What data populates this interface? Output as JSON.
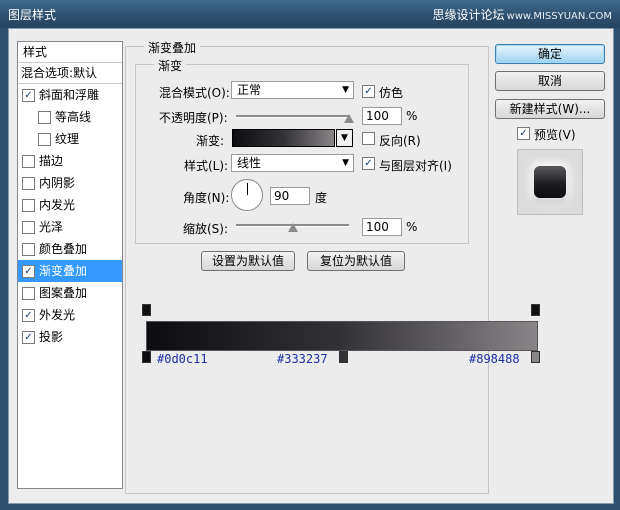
{
  "window": {
    "title": "图层样式",
    "watermark": "思缘设计论坛",
    "watermark_url": "www.MISSYUAN.COM"
  },
  "stylelist": {
    "header": "样式",
    "blend_options": "混合选项:默认",
    "items": [
      {
        "label": "斜面和浮雕",
        "checked": true,
        "indent": false,
        "selected": false
      },
      {
        "label": "等高线",
        "checked": false,
        "indent": true,
        "selected": false
      },
      {
        "label": "纹理",
        "checked": false,
        "indent": true,
        "selected": false
      },
      {
        "label": "描边",
        "checked": false,
        "indent": false,
        "selected": false
      },
      {
        "label": "内阴影",
        "checked": false,
        "indent": false,
        "selected": false
      },
      {
        "label": "内发光",
        "checked": false,
        "indent": false,
        "selected": false
      },
      {
        "label": "光泽",
        "checked": false,
        "indent": false,
        "selected": false
      },
      {
        "label": "颜色叠加",
        "checked": false,
        "indent": false,
        "selected": false
      },
      {
        "label": "渐变叠加",
        "checked": true,
        "indent": false,
        "selected": true
      },
      {
        "label": "图案叠加",
        "checked": false,
        "indent": false,
        "selected": false
      },
      {
        "label": "外发光",
        "checked": true,
        "indent": false,
        "selected": false
      },
      {
        "label": "投影",
        "checked": true,
        "indent": false,
        "selected": false
      }
    ]
  },
  "panel": {
    "outer_title": "渐变叠加",
    "inner_title": "渐变",
    "blend_mode_label": "混合模式(O):",
    "blend_mode_value": "正常",
    "dither_label": "仿色",
    "dither_checked": true,
    "opacity_label": "不透明度(P):",
    "opacity_value": "100",
    "opacity_unit": "%",
    "opacity_level": 1.0,
    "gradient_label": "渐变:",
    "reverse_label": "反向(R)",
    "reverse_checked": false,
    "style_label": "样式(L):",
    "style_value": "线性",
    "align_label": "与图层对齐(I)",
    "align_checked": true,
    "angle_label": "角度(N):",
    "angle_value": "90",
    "angle_unit": "度",
    "scale_label": "缩放(S):",
    "scale_value": "100",
    "scale_unit": "%",
    "scale_level": 0.5,
    "set_default": "设置为默认值",
    "reset_default": "复位为默认值"
  },
  "buttons": {
    "ok": "确定",
    "cancel": "取消",
    "new_style": "新建样式(W)...",
    "preview_label": "预览(V)",
    "preview_checked": true
  },
  "gradient_editor": {
    "colors": [
      "#0d0c11",
      "#333237",
      "#898488"
    ],
    "stop_labels": [
      "#0d0c11",
      "#333237",
      "#898488"
    ]
  }
}
